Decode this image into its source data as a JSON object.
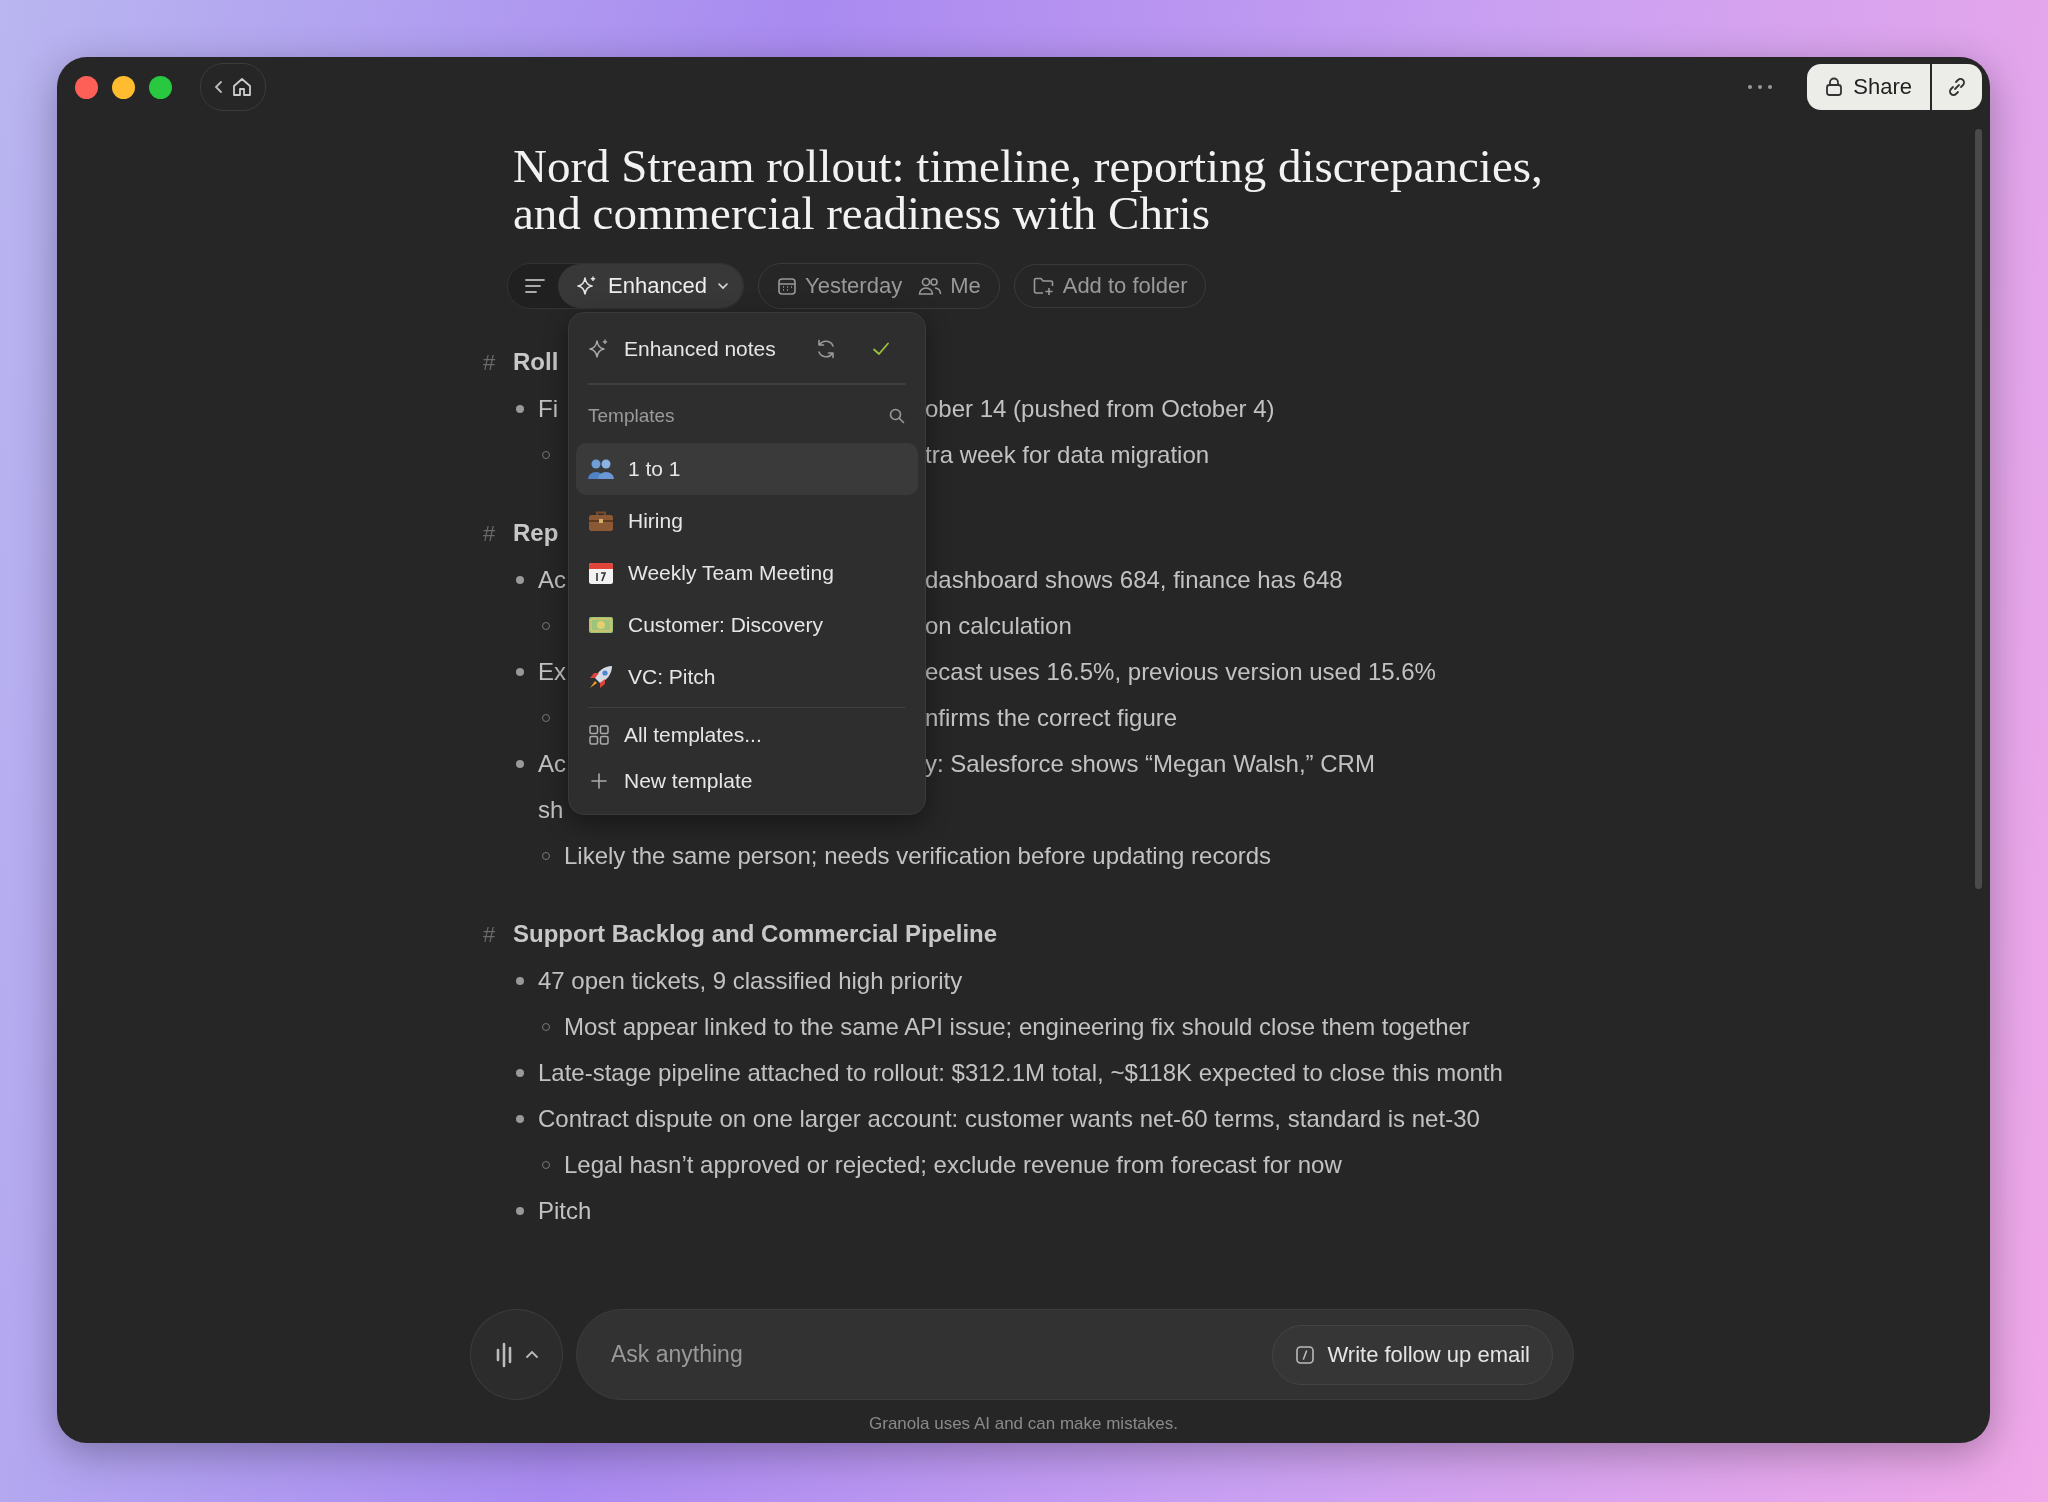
{
  "top_bar": {
    "share": "Share"
  },
  "note": {
    "title": "Nord Stream rollout: timeline, reporting discrepancies, and commercial readiness with Chris",
    "view": "Enhanced",
    "date": "Yesterday",
    "attendees": "Me",
    "folder": "Add to folder"
  },
  "body": [
    {
      "kind": "heading",
      "hash": "#",
      "text": "Roll"
    },
    {
      "kind": "bullet",
      "text": "Fi",
      "tail": "ober 14 (pushed from October 4)"
    },
    {
      "kind": "sub",
      "tail": "tra week for data migration"
    },
    {
      "kind": "heading",
      "hash": "#",
      "text": "Rep"
    },
    {
      "kind": "bullet",
      "text": "Ac",
      "tail": "dashboard shows 684, finance has 648"
    },
    {
      "kind": "sub",
      "tail": "on calculation"
    },
    {
      "kind": "bullet",
      "text": "Ex",
      "tail": "ecast uses 16.5%, previous version used 15.6%"
    },
    {
      "kind": "sub",
      "tail": "nfirms the correct figure"
    },
    {
      "kind": "bullet",
      "text": "Ac",
      "tail": "y: Salesforce shows “Megan Walsh,” CRM"
    },
    {
      "kind": "cont",
      "text": "sh"
    },
    {
      "kind": "sub",
      "text": "Likely the same person; needs verification before updating records"
    },
    {
      "kind": "heading",
      "hash": "#",
      "text": "Support Backlog and Commercial Pipeline"
    },
    {
      "kind": "bullet",
      "text": "47 open tickets, 9 classified high priority"
    },
    {
      "kind": "sub",
      "text": "Most appear linked to the same API issue; engineering fix should close them together"
    },
    {
      "kind": "bullet",
      "text": "Late-stage pipeline attached to rollout: $312.1M total, ~$118K expected to close this month"
    },
    {
      "kind": "bullet",
      "text": "Contract dispute on one larger account: customer wants net-60 terms, standard is net-30"
    },
    {
      "kind": "sub",
      "text": "Legal hasn’t approved or rejected; exclude revenue from forecast for now"
    },
    {
      "kind": "bullet",
      "text": "Pitch"
    }
  ],
  "menu": {
    "enhanced": {
      "label": "Enhanced notes",
      "checked": true
    },
    "templates_label": "Templates",
    "templates": [
      {
        "kind": "people",
        "label": "1 to 1",
        "selected": true
      },
      {
        "kind": "briefcase",
        "label": "Hiring",
        "selected": false
      },
      {
        "kind": "calendar",
        "label": "Weekly Team Meeting",
        "selected": false
      },
      {
        "kind": "money",
        "label": "Customer: Discovery",
        "selected": false
      },
      {
        "kind": "rocket",
        "label": "VC: Pitch",
        "selected": false
      }
    ],
    "actions": [
      {
        "kind": "grid",
        "label": "All templates..."
      },
      {
        "kind": "plus",
        "label": "New template"
      }
    ]
  },
  "chat": {
    "placeholder": "Ask anything",
    "action": "Write follow up email",
    "disclaimer": "Granola uses AI and can make mistakes."
  }
}
